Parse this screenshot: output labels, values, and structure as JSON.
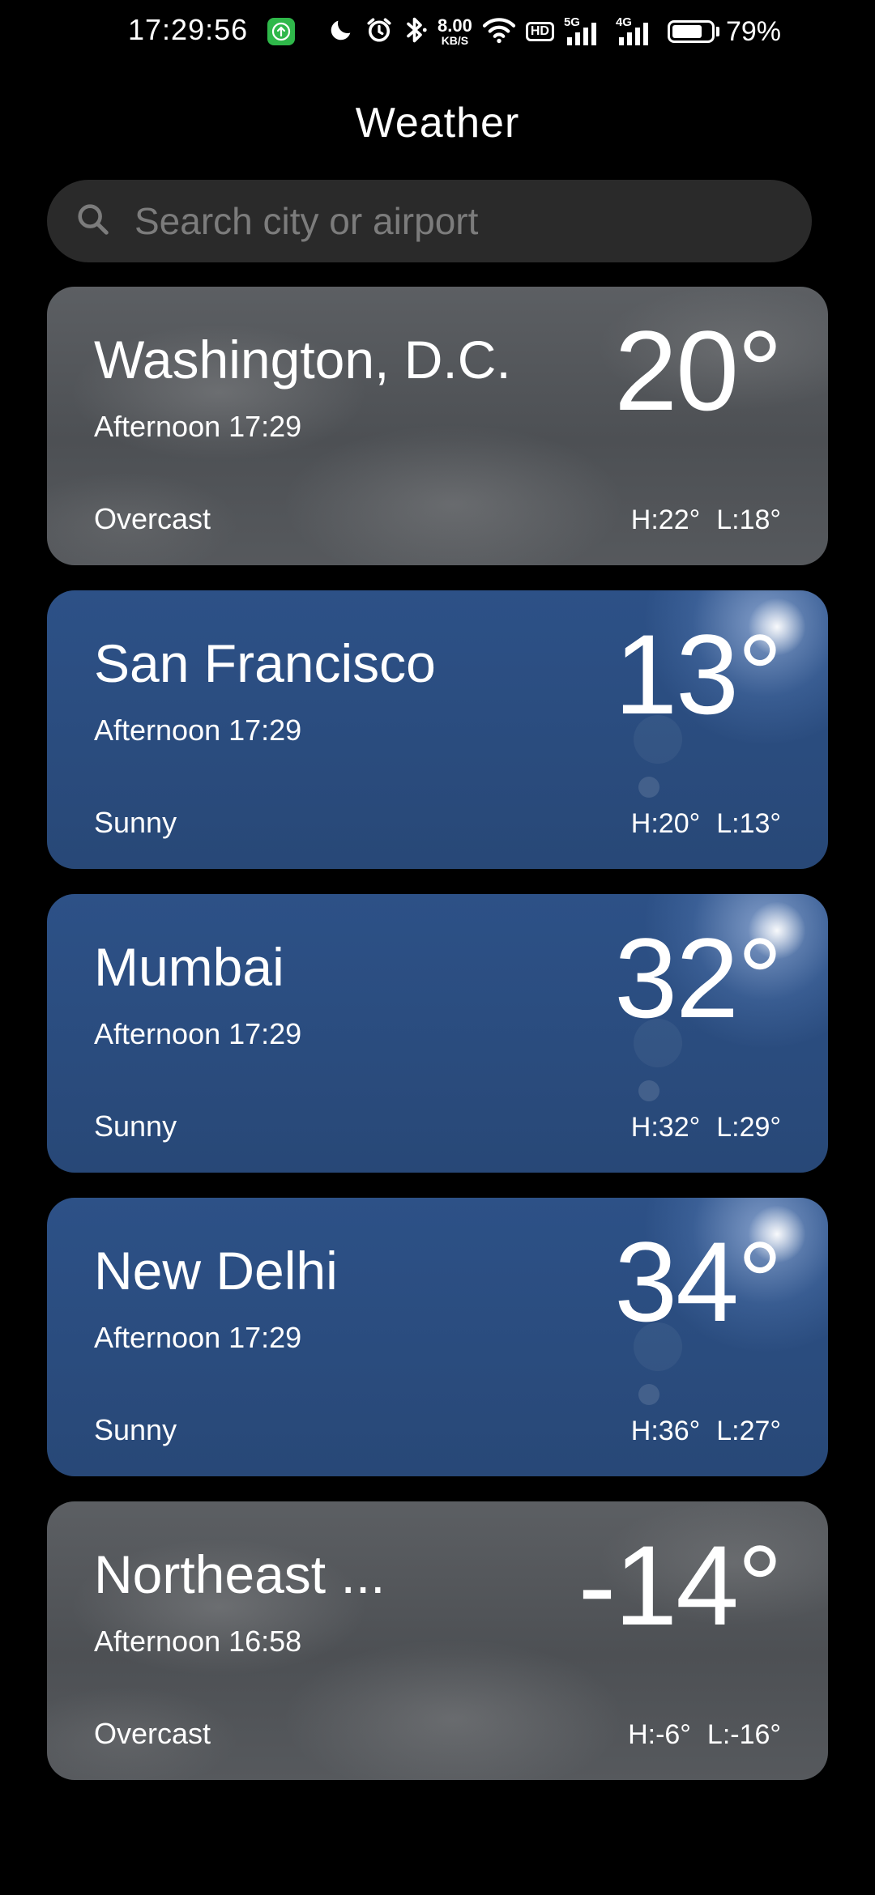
{
  "status_bar": {
    "time": "17:29:56",
    "net_speed_value": "8.00",
    "net_speed_unit": "KB/S",
    "hd_label": "HD",
    "signal_1_label": "5G",
    "signal_2_label": "4G",
    "battery_percent": 79,
    "battery_text": "79%",
    "icons": [
      "app-notification-icon",
      "moon-icon",
      "alarm-icon",
      "bluetooth-icon",
      "wifi-icon",
      "hd-icon",
      "signal-5g-icon",
      "signal-4g-icon",
      "battery-icon"
    ],
    "app_icon_color": "#2fb84a"
  },
  "header": {
    "title": "Weather"
  },
  "search": {
    "placeholder": "Search city or airport",
    "value": ""
  },
  "cities": [
    {
      "name": "Washington, D.C.",
      "time": "Afternoon 17:29",
      "condition": "Overcast",
      "temp": "20°",
      "high": "H:22°",
      "low": "L:18°",
      "style": "overcast"
    },
    {
      "name": "San Francisco",
      "time": "Afternoon 17:29",
      "condition": "Sunny",
      "temp": "13°",
      "high": "H:20°",
      "low": "L:13°",
      "style": "sunny"
    },
    {
      "name": "Mumbai",
      "time": "Afternoon 17:29",
      "condition": "Sunny",
      "temp": "32°",
      "high": "H:32°",
      "low": "L:29°",
      "style": "sunny"
    },
    {
      "name": "New Delhi",
      "time": "Afternoon 17:29",
      "condition": "Sunny",
      "temp": "34°",
      "high": "H:36°",
      "low": "L:27°",
      "style": "sunny"
    },
    {
      "name": "Northeast ...",
      "time": "Afternoon 16:58",
      "condition": "Overcast",
      "temp": "-14°",
      "high": "H:-6°",
      "low": "L:-16°",
      "style": "overcast"
    }
  ],
  "colors": {
    "background": "#000000",
    "search_bg": "#2a2a2a",
    "overcast_card": "#55585c",
    "sunny_card": "#2b4d80"
  }
}
